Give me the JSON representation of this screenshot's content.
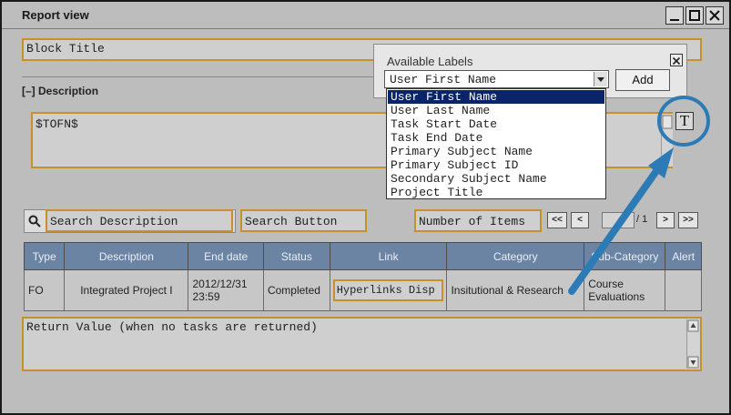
{
  "window": {
    "title": "Report view"
  },
  "block_title": {
    "value": "Block Title"
  },
  "description": {
    "toggle": "[–]",
    "label": "Description",
    "value": "$TOFN$",
    "insert_label_button": "T"
  },
  "search": {
    "description_placeholder": "Search Description",
    "button_label": "Search Button"
  },
  "pagination": {
    "items_label": "Number of Items",
    "first": "<<",
    "prev": "<",
    "page_value": "",
    "total": "/ 1",
    "next": ">",
    "last": ">>"
  },
  "table": {
    "headers": [
      "Type",
      "Description",
      "End date",
      "Status",
      "Link",
      "Category",
      "Sub-Category",
      "Alert"
    ],
    "rows": [
      {
        "type": "FO",
        "description": "Integrated Project I",
        "end_date": "2012/12/31 23:59",
        "status": "Completed",
        "link": "Hyperlinks Disp",
        "category": "Insitutional & Research",
        "sub_category": "Course Evaluations",
        "alert": ""
      }
    ]
  },
  "return_value": {
    "value": "Return Value (when no tasks are returned)"
  },
  "available_labels": {
    "title": "Available Labels",
    "selected": "User First Name",
    "add_button": "Add",
    "options": [
      "User First Name",
      "User Last Name",
      "Task Start Date",
      "Task End Date",
      "Primary Subject Name",
      "Primary Subject ID",
      "Secondary Subject Name",
      "Project Title"
    ]
  },
  "colors": {
    "accent_border": "#c8902c",
    "table_header": "#6c84a4",
    "selection": "#0a246a",
    "annotation": "#2c7bb6"
  },
  "icons": [
    "minimize-icon",
    "maximize-icon",
    "close-icon",
    "search-icon",
    "chevron-down-icon",
    "scroll-up-icon",
    "scroll-down-icon",
    "text-label-icon",
    "annotation-arrow-icon"
  ]
}
